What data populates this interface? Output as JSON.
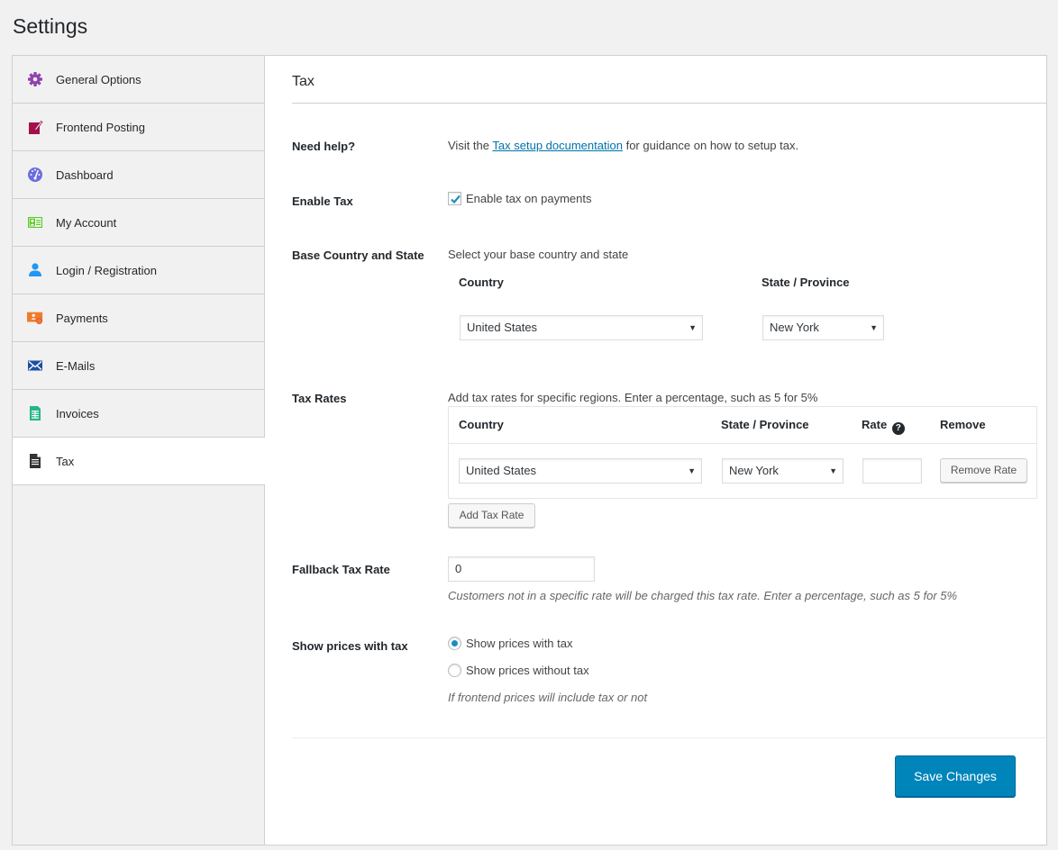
{
  "page": {
    "title": "Settings"
  },
  "sidebar": {
    "items": [
      {
        "label": "General Options",
        "icon": "gear-icon",
        "color": "#8e44ad",
        "active": false
      },
      {
        "label": "Frontend Posting",
        "icon": "edit-post-icon",
        "color": "#a3114a",
        "active": false
      },
      {
        "label": "Dashboard",
        "icon": "dashboard-gauge-icon",
        "color": "#6c6cdf",
        "active": false
      },
      {
        "label": "My Account",
        "icon": "id-card-icon",
        "color": "#5cc92b",
        "active": false
      },
      {
        "label": "Login / Registration",
        "icon": "user-icon",
        "color": "#2196f3",
        "active": false
      },
      {
        "label": "Payments",
        "icon": "payment-icon",
        "color": "#f07c2b",
        "active": false
      },
      {
        "label": "E-Mails",
        "icon": "envelope-icon",
        "color": "#1c4fa1",
        "active": false
      },
      {
        "label": "Invoices",
        "icon": "invoice-icon",
        "color": "#26b58a",
        "active": true
      },
      {
        "label": "Tax",
        "icon": "document-icon",
        "color": "#333333",
        "active": true
      }
    ]
  },
  "section": {
    "title": "Tax",
    "need_help": {
      "label": "Need help?",
      "prefix": "Visit the",
      "link": "Tax setup documentation",
      "suffix": "for guidance on how to setup tax."
    },
    "enable_tax": {
      "label": "Enable Tax",
      "checkbox_label": "Enable tax on payments",
      "checked": true
    },
    "base_country": {
      "label": "Base Country and State",
      "description": "Select your base country and state",
      "country_header": "Country",
      "state_header": "State / Province",
      "country_value": "United States",
      "state_value": "New York"
    },
    "tax_rates": {
      "label": "Tax Rates",
      "description": "Add tax rates for specific regions. Enter a percentage, such as 5 for 5%",
      "headers": {
        "country": "Country",
        "state": "State / Province",
        "rate": "Rate",
        "remove": "Remove"
      },
      "help_glyph": "?",
      "rows": [
        {
          "country": "United States",
          "state": "New York",
          "rate": "",
          "remove_label": "Remove Rate"
        }
      ],
      "add_label": "Add Tax Rate"
    },
    "fallback": {
      "label": "Fallback Tax Rate",
      "value": "0",
      "description": "Customers not in a specific rate will be charged this tax rate. Enter a percentage, such as 5 for 5%"
    },
    "show_prices": {
      "label": "Show prices with tax",
      "options": [
        {
          "label": "Show prices with tax",
          "selected": true
        },
        {
          "label": "Show prices without tax",
          "selected": false
        }
      ],
      "description": "If frontend prices will include tax or not"
    },
    "save_label": "Save Changes"
  },
  "colors": {
    "accent": "#0085ba",
    "link": "#0073aa",
    "border": "#ccd0d4"
  },
  "select_arrow": "▼"
}
